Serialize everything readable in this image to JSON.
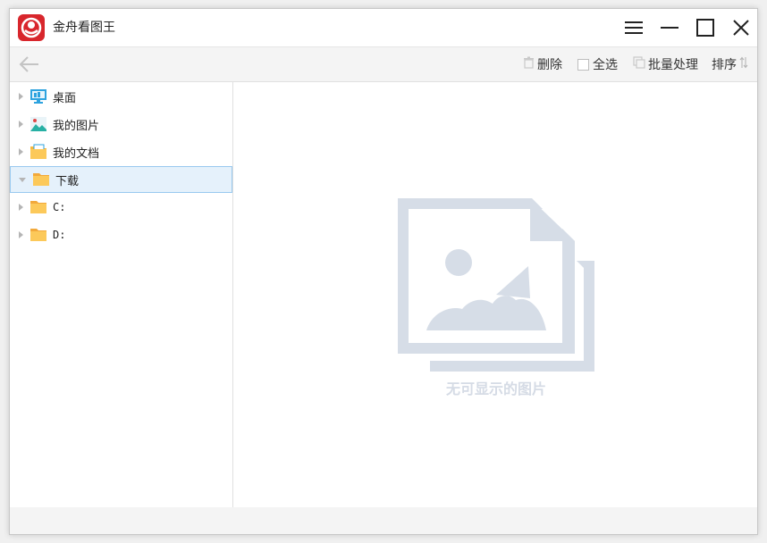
{
  "app": {
    "title": "金舟看图王",
    "logo_icon": "app-logo-icon",
    "accent": "#d8262c"
  },
  "window_controls": {
    "menu_icon": "hamburger-menu-icon",
    "minimize_icon": "minimize-icon",
    "maximize_icon": "maximize-icon",
    "close_icon": "close-icon"
  },
  "toolbar": {
    "back_icon": "arrow-left-icon",
    "delete_label": "删除",
    "select_all_label": "全选",
    "batch_label": "批量处理",
    "sort_label": "排序"
  },
  "sidebar": {
    "items": [
      {
        "label": "桌面",
        "icon": "desktop-icon",
        "selected": false
      },
      {
        "label": "我的图片",
        "icon": "pictures-folder-icon",
        "selected": false
      },
      {
        "label": "我的文档",
        "icon": "documents-folder-icon",
        "selected": false
      },
      {
        "label": "下载",
        "icon": "folder-icon",
        "selected": true
      },
      {
        "label": "C:",
        "icon": "folder-icon",
        "selected": false
      },
      {
        "label": "D:",
        "icon": "folder-icon",
        "selected": false
      }
    ],
    "selected_bg": "#e5f1fb"
  },
  "main": {
    "empty_text": "无可显示的图片",
    "empty_color": "#d5dbe5"
  }
}
